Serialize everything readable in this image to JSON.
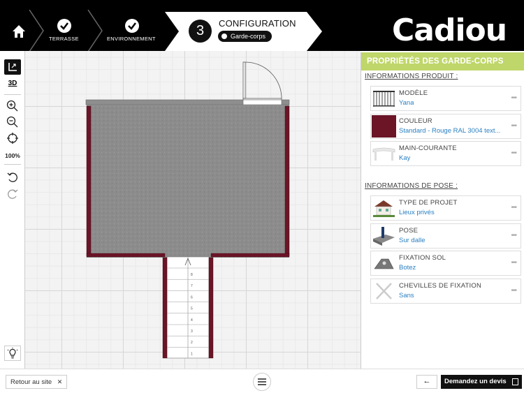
{
  "brand": {
    "logo_text": "Cadiou"
  },
  "steps": [
    {
      "label": "TERRASSE",
      "done": true
    },
    {
      "label": "ENVIRONNEMENT",
      "done": true
    },
    {
      "number": "3",
      "label": "CONFIGURATION",
      "sub": "Garde-corps",
      "current": true
    }
  ],
  "toolbar": {
    "view_3d": "3D",
    "zoom_level": "100%"
  },
  "plan": {
    "stair_numbers": [
      "8",
      "7",
      "6",
      "5",
      "4",
      "3",
      "2",
      "1"
    ]
  },
  "panel": {
    "title": "PROPRIÉTÉS DES GARDE-CORPS",
    "product_section": "INFORMATIONS PRODUIT :",
    "product_items": [
      {
        "label": "MODÈLE",
        "value": "Yana",
        "icon": "railing-model-thumb"
      },
      {
        "label": "COULEUR",
        "value": "Standard - Rouge RAL 3004 text...",
        "icon": "color-swatch",
        "color": "#6b1527"
      },
      {
        "label": "MAIN-COURANTE",
        "value": "Kay",
        "icon": "handrail-thumb"
      }
    ],
    "pose_section": "INFORMATIONS DE POSE :",
    "pose_items": [
      {
        "label": "TYPE DE PROJET",
        "value": "Lieux privés",
        "icon": "house-thumb"
      },
      {
        "label": "POSE",
        "value": "Sur dalle",
        "icon": "slab-mount-thumb"
      },
      {
        "label": "FIXATION SOL",
        "value": "Botez",
        "icon": "floor-bracket-thumb"
      },
      {
        "label": "CHEVILLES DE FIXATION",
        "value": "Sans",
        "icon": "cross-thumb"
      }
    ],
    "more_glyph": "•••"
  },
  "footer": {
    "back_to_site": "Retour au site",
    "close_glyph": "✕",
    "back_arrow": "←",
    "quote_button": "Demandez un devis"
  },
  "colors": {
    "accent": "#bfd66a",
    "link": "#2a7fc1",
    "railing": "#6b1527",
    "floor": "#8c8c8c"
  }
}
